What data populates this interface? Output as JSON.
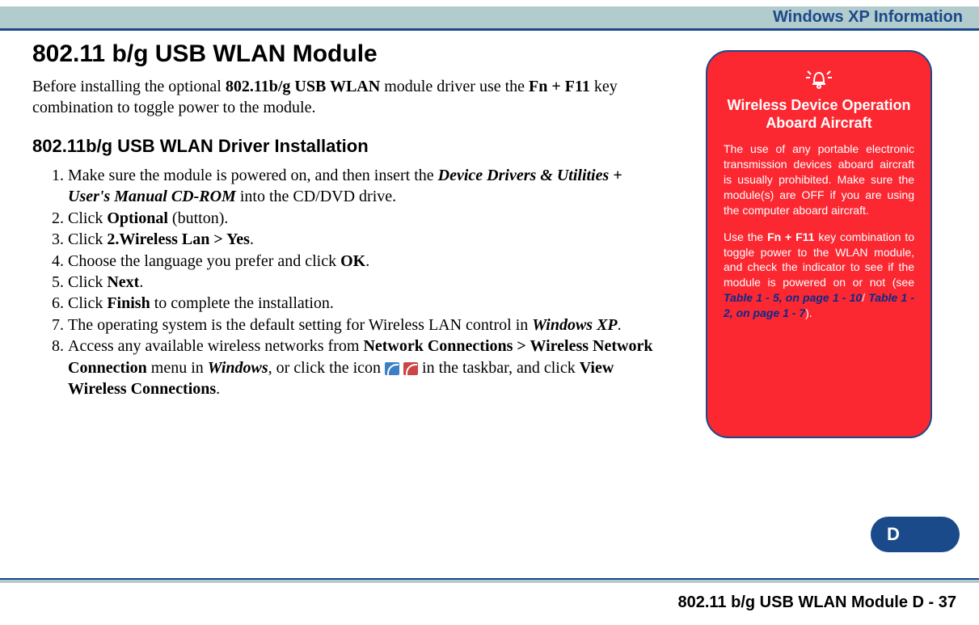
{
  "header": {
    "title": "Windows XP Information"
  },
  "main": {
    "heading": "802.11 b/g USB WLAN Module",
    "intro_html": "Before installing the optional <b>802.11b/g USB WLAN</b> module driver use the <b>Fn + F11</b> key combination to toggle power to the module.",
    "subheading": "802.11b/g USB WLAN Driver Installation",
    "steps": [
      "Make sure the module is powered on, and then insert the <b><i>Device Drivers & Utilities + User's Manual CD-ROM</i></b> into the CD/DVD drive.",
      "Click <b>Optional</b> (button).",
      "Click <b>2.Wireless Lan > Yes</b>.",
      "Choose the language you prefer and click <b>OK</b>.",
      "Click <b>Next</b>.",
      "Click <b>Finish</b> to complete the installation.",
      "The operating system is the default setting for Wireless LAN control in <b><i>Windows XP</i></b>.",
      "Access any available wireless networks from <b>Network Connections > Wireless Network Connection</b> menu in <b><i>Windows</i></b>, or click the icon <span class=\"wifi-icon\" data-name=\"wifi-on-icon\" data-interactable=\"false\"></span> <span class=\"wifi-icon wifi-x\" data-name=\"wifi-off-icon\" data-interactable=\"false\"></span> in the taskbar, and click <b>View Wireless Connections</b>."
    ]
  },
  "sidebox": {
    "title": "Wireless Device Operation Aboard Aircraft",
    "p1": "The use of any portable electronic transmission devices aboard aircraft is usually prohibited. Make sure the module(s) are OFF if you are using the computer aboard aircraft.",
    "p2_html": "Use the <b>Fn + F11</b> key combination to toggle power to the WLAN module, and check the indicator to see if the module is powered on or not (see <span class=\"link-blue\">Table 1 - 5, on page 1 - 10</span>/ <span class=\"link-blue\">Table 1 - 2, on page 1 - 7</span>)."
  },
  "tab": {
    "label": "D"
  },
  "footer": {
    "section": "802.11 b/g USB WLAN Module",
    "page": "D - 37"
  }
}
